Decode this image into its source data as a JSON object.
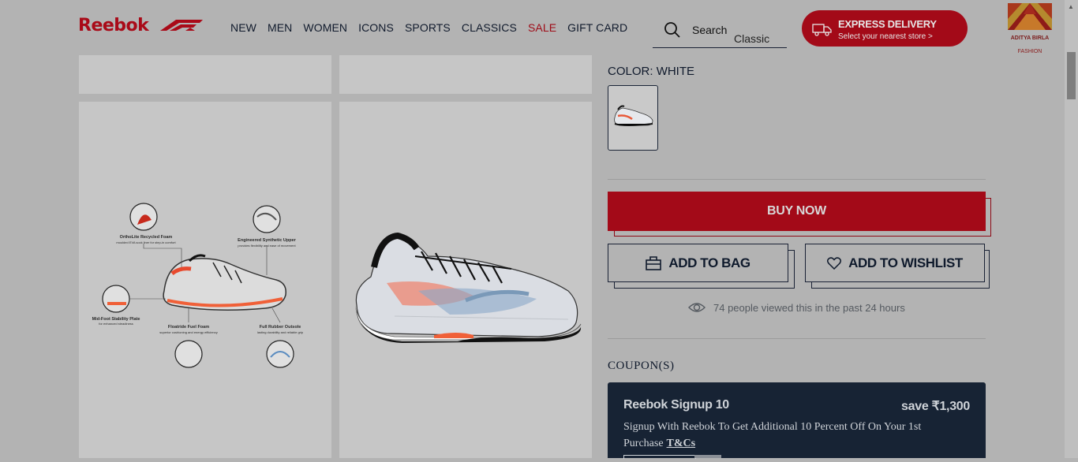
{
  "header": {
    "logo": "Reebok",
    "nav": [
      {
        "label": "NEW"
      },
      {
        "label": "MEN"
      },
      {
        "label": "WOMEN"
      },
      {
        "label": "ICONS"
      },
      {
        "label": "SPORTS"
      },
      {
        "label": "CLASSICS"
      },
      {
        "label": "SALE",
        "color": "#9e0a16"
      },
      {
        "label": "GIFT CARD"
      }
    ],
    "search": {
      "label": "Search",
      "value": "Classic"
    },
    "express": {
      "title": "EXPRESS DELIVERY",
      "subtitle": "Select your nearest store >"
    },
    "brand": {
      "name": "ADITYA BIRLA",
      "sub": "FASHION"
    }
  },
  "gallery": {
    "features": [
      {
        "title": "OrthoLite Recycled Foam",
        "desc": "moulded EVA sock liner for step-in comfort"
      },
      {
        "title": "Engineered Synthetic Upper",
        "desc": "provides flexibility and ease of movement"
      },
      {
        "title": "Mid-Foot Stability Plate",
        "desc": "for enhanced steadiness"
      },
      {
        "title": "Floatride Fuel Foam",
        "desc": "superior cushioning and energy efficiency"
      },
      {
        "title": "Full Rubber Outsole",
        "desc": "lasting durability and reliable grip"
      }
    ]
  },
  "product": {
    "color_label": "COLOR:",
    "color_value": "WHITE",
    "buy_now": "BUY NOW",
    "add_to_bag": "ADD TO BAG",
    "add_to_wishlist": "ADD TO WISHLIST",
    "viewers": "74 people viewed this in the past 24 hours"
  },
  "coupons": {
    "heading": "COUPON(S)",
    "items": [
      {
        "name": "Reebok Signup 10",
        "save": "save ₹1,300",
        "description": "Signup With Reebok To Get Additional 10 Percent Off On Your 1st Purchase",
        "terms": "T&Cs"
      }
    ]
  },
  "colors": {
    "brand_red": "#a30a18",
    "navy": "#172334",
    "overlay_gray": "#b3b3b3"
  }
}
